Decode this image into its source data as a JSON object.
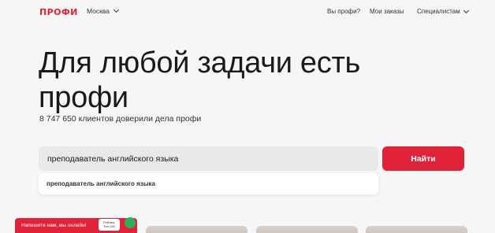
{
  "header": {
    "logo": "ПРОФИ",
    "city": "Москва",
    "nav": [
      "Вы профи?",
      "Мои заказы",
      "Специалистам"
    ]
  },
  "hero": {
    "title_line1": "Для любой задачи есть",
    "title_line2": "профи",
    "stats": "8 747 650 клиентов доверили дела профи"
  },
  "search": {
    "value": "преподаватель английского языка",
    "button": "Найти",
    "suggestions": [
      "преподаватель английского языка"
    ]
  },
  "chat": {
    "text": "Напишите нам, мы онлайн!",
    "badge": "Рейтинг Топ-100"
  },
  "colors": {
    "brand": "#e1233a",
    "background": "#f6f6f6",
    "input_bg": "#e9e9e9"
  }
}
